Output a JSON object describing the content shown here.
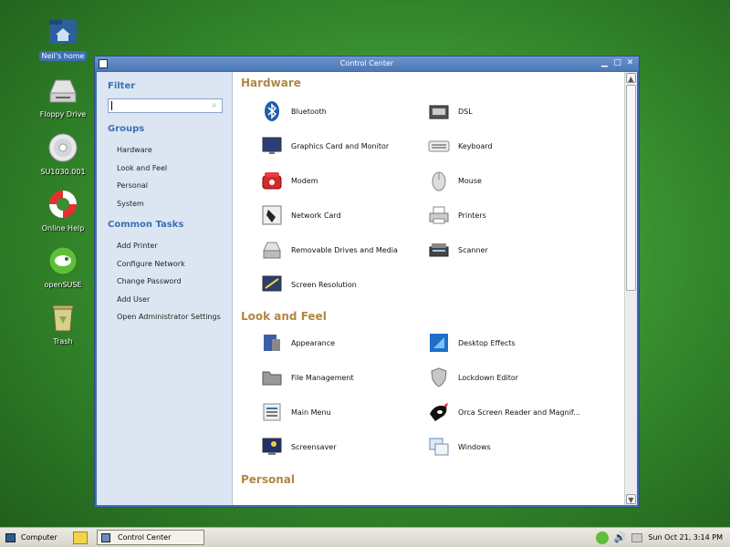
{
  "desktop": {
    "icons": [
      {
        "label": "Neil's home",
        "icon": "home-folder-icon",
        "selected": true
      },
      {
        "label": "Floppy Drive",
        "icon": "floppy-drive-icon"
      },
      {
        "label": "SU1030.001",
        "icon": "cd-disc-icon"
      },
      {
        "label": "Online Help",
        "icon": "lifebuoy-icon"
      },
      {
        "label": "openSUSE",
        "icon": "opensuse-logo-icon"
      },
      {
        "label": "Trash",
        "icon": "trash-icon"
      }
    ]
  },
  "window": {
    "title": "Control Center",
    "controls": {
      "minimize": "▁",
      "maximize": "□",
      "close": "✕"
    }
  },
  "sidebar": {
    "filter_heading": "Filter",
    "search_value": "",
    "groups_heading": "Groups",
    "groups": [
      "Hardware",
      "Look and Feel",
      "Personal",
      "System"
    ],
    "tasks_heading": "Common Tasks",
    "tasks": [
      "Add Printer",
      "Configure Network",
      "Change Password",
      "Add User",
      "Open Administrator Settings"
    ]
  },
  "content": {
    "hardware": {
      "title": "Hardware",
      "items": [
        {
          "label": "Bluetooth",
          "icon": "bluetooth-icon"
        },
        {
          "label": "DSL",
          "icon": "dsl-modem-icon"
        },
        {
          "label": "Graphics Card and Monitor",
          "icon": "monitor-icon"
        },
        {
          "label": "Keyboard",
          "icon": "keyboard-icon"
        },
        {
          "label": "Modem",
          "icon": "phone-modem-icon"
        },
        {
          "label": "Mouse",
          "icon": "mouse-icon"
        },
        {
          "label": "Network Card",
          "icon": "network-card-icon"
        },
        {
          "label": "Printers",
          "icon": "printer-icon"
        },
        {
          "label": "Removable Drives and Media",
          "icon": "removable-drive-icon"
        },
        {
          "label": "Scanner",
          "icon": "scanner-icon"
        },
        {
          "label": "Screen Resolution",
          "icon": "screen-resolution-icon"
        }
      ]
    },
    "look": {
      "title": "Look and Feel",
      "items": [
        {
          "label": "Appearance",
          "icon": "appearance-icon"
        },
        {
          "label": "Desktop Effects",
          "icon": "desktop-effects-icon"
        },
        {
          "label": "File Management",
          "icon": "folder-icon"
        },
        {
          "label": "Lockdown Editor",
          "icon": "shield-icon"
        },
        {
          "label": "Main Menu",
          "icon": "main-menu-icon"
        },
        {
          "label": "Orca Screen Reader and Magnif...",
          "icon": "orca-icon"
        },
        {
          "label": "Screensaver",
          "icon": "screensaver-icon"
        },
        {
          "label": "Windows",
          "icon": "windows-icon"
        }
      ]
    },
    "personal": {
      "title": "Personal"
    }
  },
  "taskbar": {
    "computer_label": "Computer",
    "task_label": "Control Center",
    "clock": "Sun Oct 21,  3:14 PM"
  }
}
